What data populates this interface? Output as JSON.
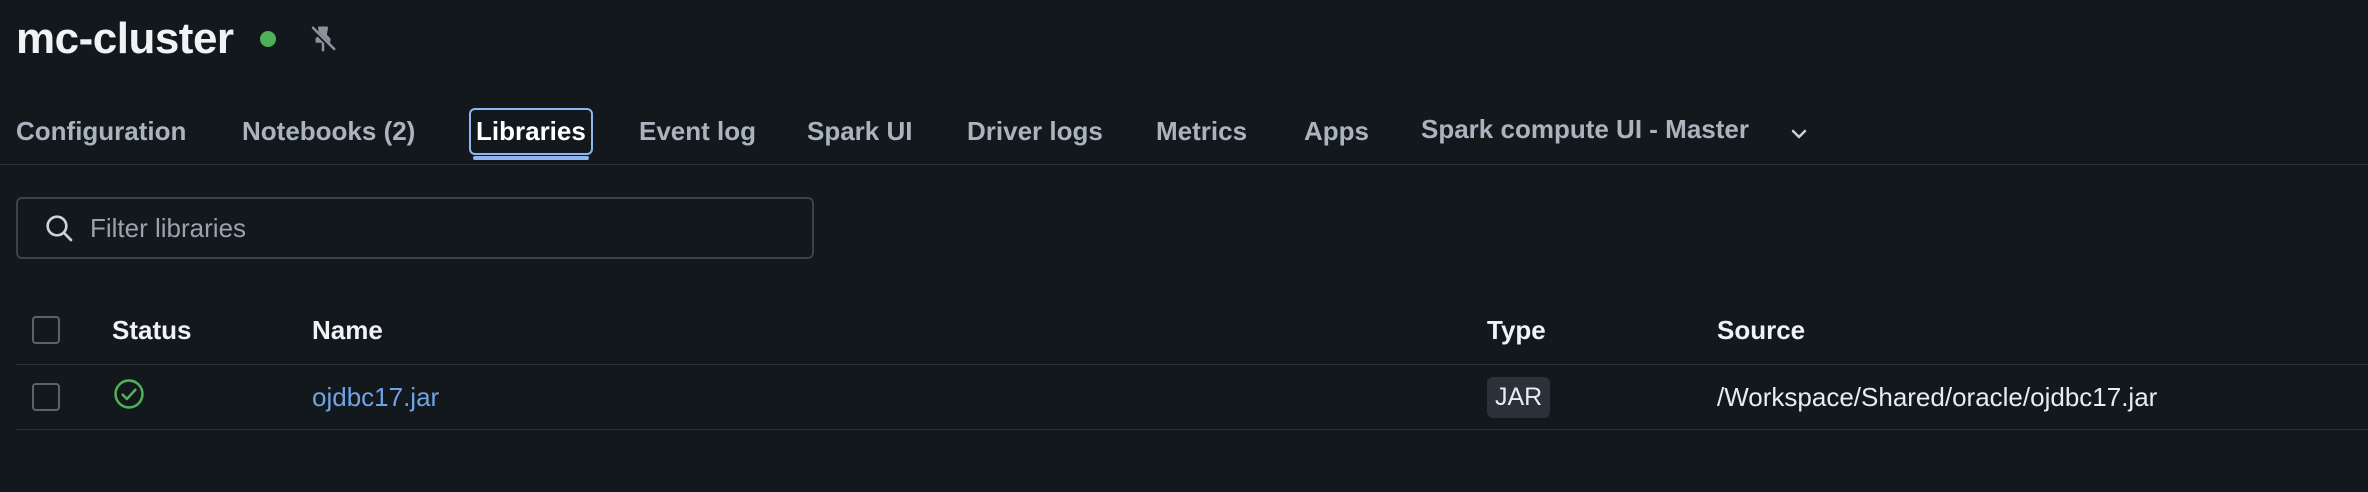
{
  "header": {
    "title": "mc-cluster",
    "status_color": "#4fb05a",
    "pin_icon": "pin-off-icon"
  },
  "tabs": [
    {
      "label": "Configuration",
      "active": false
    },
    {
      "label": "Notebooks (2)",
      "active": false
    },
    {
      "label": "Libraries",
      "active": true
    },
    {
      "label": "Event log",
      "active": false
    },
    {
      "label": "Spark UI",
      "active": false
    },
    {
      "label": "Driver logs",
      "active": false
    },
    {
      "label": "Metrics",
      "active": false
    },
    {
      "label": "Apps",
      "active": false
    },
    {
      "label": "Spark compute UI - Master",
      "active": false
    }
  ],
  "filter": {
    "placeholder": "Filter libraries",
    "value": ""
  },
  "table": {
    "columns": [
      "Status",
      "Name",
      "Type",
      "Source"
    ],
    "rows": [
      {
        "status": "installed",
        "name": "ojdbc17.jar",
        "type": "JAR",
        "source": "/Workspace/Shared/oracle/ojdbc17.jar"
      }
    ]
  },
  "colors": {
    "background": "#13181d",
    "accent": "#8fb4ee",
    "link": "#6fa3e6",
    "success": "#4fb05a"
  }
}
